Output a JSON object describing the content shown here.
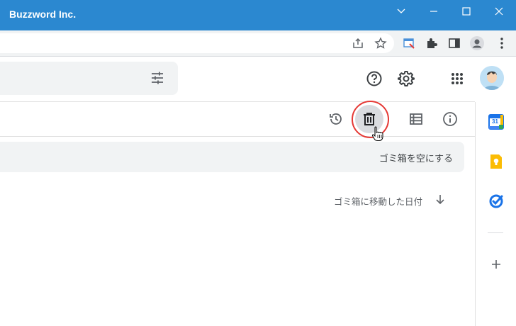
{
  "window": {
    "title": "Buzzword Inc."
  },
  "trash": {
    "empty_trash_label": "ゴミ箱を空にする",
    "sort_label": "ゴミ箱に移動した日付"
  },
  "sidepanel": {
    "calendar_day": "31"
  },
  "colors": {
    "titlebar": "#2b88d0",
    "highlight_ring": "#e53935",
    "calendar_blue": "#1a73e8",
    "keep_yellow": "#fbbc04",
    "tasks_blue": "#1a73e8"
  }
}
